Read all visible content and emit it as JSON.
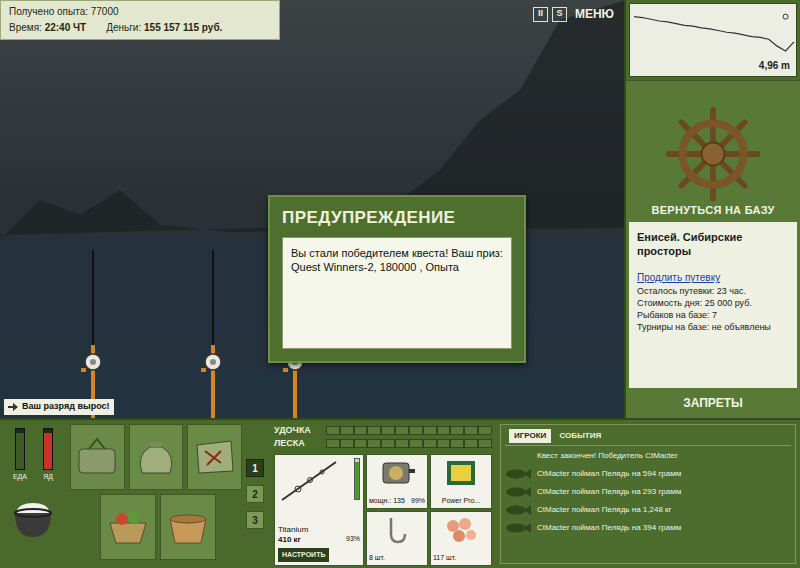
{
  "hud": {
    "experience": "Получено опыта: 77000",
    "time_label": "Время:",
    "time": "22:40 ЧТ",
    "money_label": "Деньги:",
    "money": "155 157 115 руб."
  },
  "top_buttons": [
    "II",
    "S",
    "МЕНЮ"
  ],
  "depth": {
    "reading": "4,96 m",
    "profile": [
      1.0,
      1.1,
      1.3,
      1.5,
      1.6,
      1.8,
      2.0,
      2.1,
      2.3,
      2.4,
      2.6,
      2.8,
      2.9,
      3.1,
      3.3,
      3.4,
      3.6,
      4.4,
      4.96,
      3.9
    ]
  },
  "base": {
    "button": "ВЕРНУТЬСЯ НА БАЗУ",
    "location": "Енисей. Сибирские просторы",
    "extend_link": "Продлить путевку",
    "info": [
      "Осталось путевки: 23 час.",
      "Стоимость дня: 25 000 руб.",
      "Рыбаков на базе: 7",
      "Турниры на базе: не объявлены"
    ],
    "bans": "ЗАПРЕТЫ"
  },
  "dialog": {
    "title": "ПРЕДУПРЕЖДЕНИЕ",
    "message": "Вы стали победителем квеста! Ваш приз: Quest Winners-2, 180000 , Опыта"
  },
  "notice": {
    "text": "Ваш разряд вырос!"
  },
  "meters": [
    {
      "label": "ЕДА",
      "level": 0.9,
      "color": "#3d5a26"
    },
    {
      "label": "ЯД",
      "level": 0.9,
      "color": "#c8322b"
    }
  ],
  "slots": [
    {
      "label": "1",
      "selected": true
    },
    {
      "label": "2",
      "selected": false
    },
    {
      "label": "3",
      "selected": false
    }
  ],
  "tension": [
    {
      "label": "УДОЧКА",
      "level": 0
    },
    {
      "label": "ЛЕСКА",
      "level": 0
    }
  ],
  "tackle": {
    "rod": {
      "name": "Titanium",
      "capacity": "410 кг",
      "condition": "93%",
      "level": 0.93,
      "button": "НАСТРОИТЬ"
    },
    "reel": {
      "power": "мощн.: 135",
      "condition": "99%",
      "level": 0.99
    },
    "line": {
      "name": "Power Pro..."
    },
    "hook": {
      "count": "8 шт."
    },
    "bait": {
      "count": "117 шт."
    }
  },
  "events": {
    "tabs": [
      {
        "label": "ИГРОКИ",
        "selected": true
      },
      {
        "label": "СОБЫТИЯ",
        "selected": false
      }
    ],
    "messages": [
      {
        "kind": "info",
        "text": "Квест закончен! Победитель CtMacter"
      },
      {
        "kind": "catch",
        "text": "CtMacter поймал Пелядь на 594 грамм"
      },
      {
        "kind": "catch",
        "text": "CtMacter поймал Пелядь на 293 грамм"
      },
      {
        "kind": "catch",
        "text": "CtMacter поймал Пелядь на 1,248 кг"
      },
      {
        "kind": "catch",
        "text": "CtMacter поймал Пелядь на 394 грамм"
      }
    ]
  }
}
